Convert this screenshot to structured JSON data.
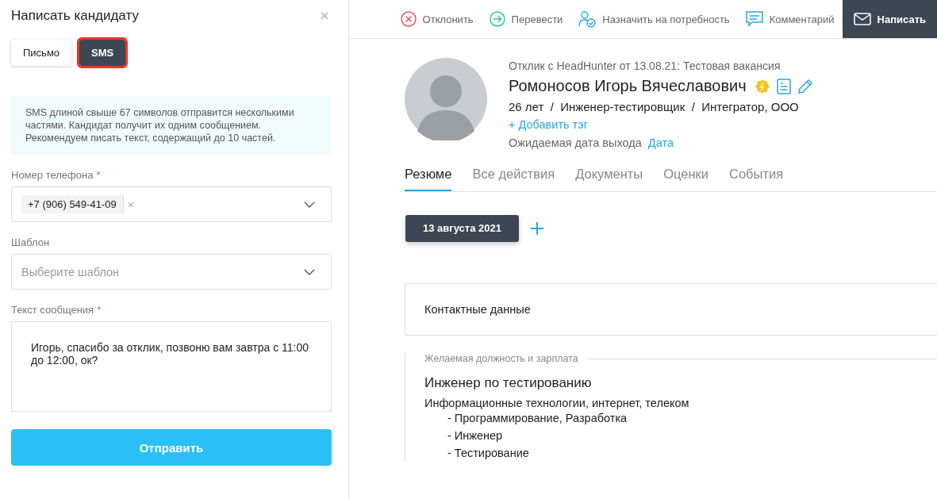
{
  "dialog": {
    "title": "Написать кандидату",
    "modes": [
      {
        "label": "Письмо",
        "selected": false,
        "highlighted": false
      },
      {
        "label": "SMS",
        "selected": true,
        "highlighted": true
      }
    ],
    "notice": "SMS длиной свыше 67 символов отправится несколькими частями. Кандидат получит их одним сообщением. Рекомендуем писать текст, содержащий до 10 частей.",
    "phone": {
      "label": "Номер телефона",
      "required_mark": "*",
      "value": "+7 (906) 549-41-09"
    },
    "template": {
      "label": "Шаблон",
      "placeholder": "Выберите шаблон"
    },
    "message": {
      "label": "Текст сообщения",
      "required_mark": "*",
      "value": "Игорь, спасибо за отклик,  позвоню вам завтра с 11:00 до 12:00, ок?"
    },
    "submit": "Отправить"
  },
  "toolbar": [
    {
      "kind": "reject",
      "label": "Отклонить",
      "selected": false
    },
    {
      "kind": "transfer",
      "label": "Перевести",
      "selected": false
    },
    {
      "kind": "assign",
      "label": "Назначить на потребность",
      "selected": false
    },
    {
      "kind": "comment",
      "label": "Комментарий",
      "selected": false
    },
    {
      "kind": "write",
      "label": "Написать",
      "selected": true
    }
  ],
  "candidate": {
    "source": "Отклик с HeadHunter от 13.08.21: Тестовая вакансия",
    "name": "Ромоносов Игорь Вячеславович",
    "details": "26 лет  /  Инженер-тестировщик  /  Интегратор, ООО",
    "add_tag": "+ Добавить тэг",
    "exit_label": "Ожидаемая дата выхода",
    "exit_link": "Дата"
  },
  "tabs": [
    {
      "label": "Резюме",
      "selected": true
    },
    {
      "label": "Все действия",
      "selected": false
    },
    {
      "label": "Документы",
      "selected": false
    },
    {
      "label": "Оценки",
      "selected": false
    },
    {
      "label": "События",
      "selected": false
    }
  ],
  "resume": {
    "date": "13 августа 2021",
    "contacts": "Контактные данные",
    "section_title": "Желаемая должность и зарплата",
    "position": "Инженер по тестированию",
    "field": "Информационные технологии, интернет, телеком",
    "specializations": [
      "- Программирование, Разработка",
      "- Инженер",
      "- Тестирование"
    ]
  }
}
